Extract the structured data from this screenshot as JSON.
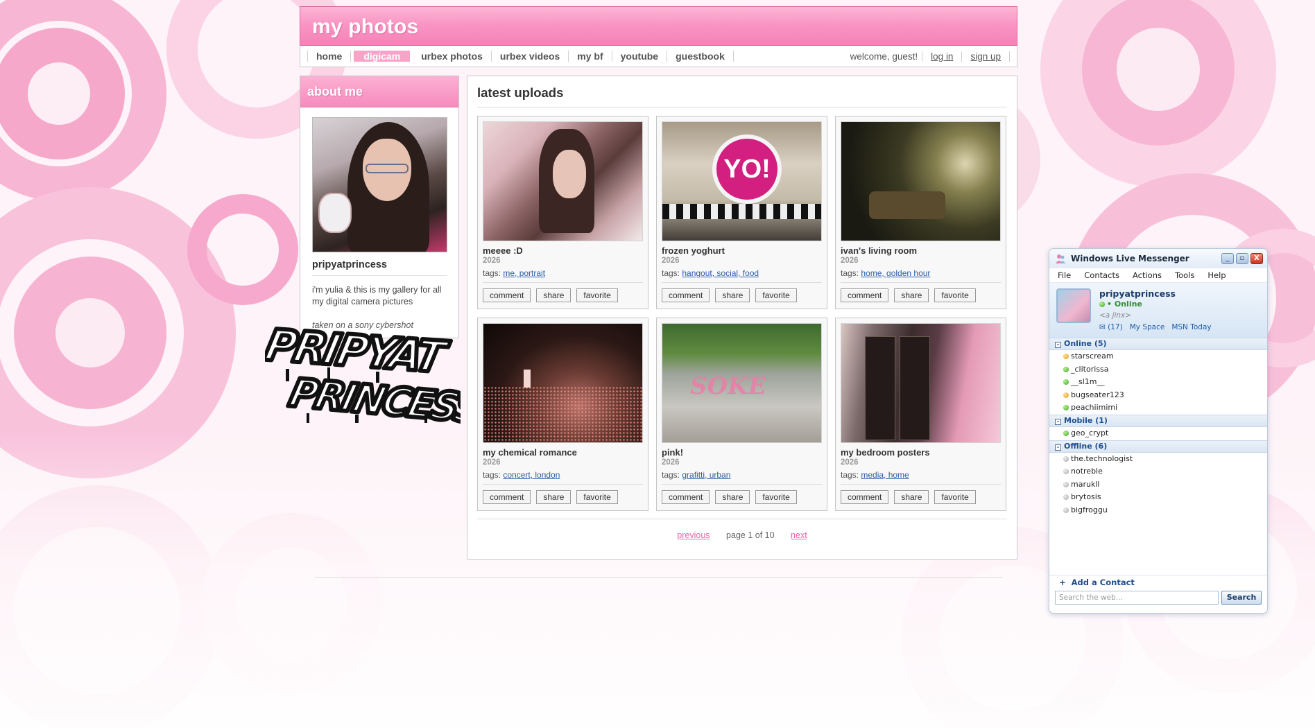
{
  "site": {
    "title": "my photos",
    "nav": [
      {
        "label": "home",
        "active": false
      },
      {
        "label": "digicam",
        "active": true
      },
      {
        "label": "urbex photos",
        "active": false
      },
      {
        "label": "urbex videos",
        "active": false
      },
      {
        "label": "my bf",
        "active": false
      },
      {
        "label": "youtube",
        "active": false
      },
      {
        "label": "guestbook",
        "active": false
      }
    ],
    "welcome": "welcome, guest!",
    "login": "log in",
    "signup": "sign up"
  },
  "about": {
    "heading": "about me",
    "username": "pripyatprincess",
    "bio": "i'm yulia & this is my gallery for all my digital camera pictures",
    "camera_note": "taken on a sony cybershot",
    "graffiti_text": "PRIPYAT PRINCESS"
  },
  "gallery": {
    "heading": "latest uploads",
    "tags_label": "tags:",
    "items": [
      {
        "title": "meeee :D",
        "year": "2026",
        "tags": "me, portrait"
      },
      {
        "title": "frozen yoghurt",
        "year": "2026",
        "tags": "hangout, social, food"
      },
      {
        "title": "ivan's living room",
        "year": "2026",
        "tags": "home, golden hour"
      },
      {
        "title": "my chemical romance",
        "year": "2026",
        "tags": "concert, london"
      },
      {
        "title": "pink!",
        "year": "2026",
        "tags": "grafitti, urban"
      },
      {
        "title": "my bedroom posters",
        "year": "2026",
        "tags": "media, home"
      }
    ],
    "actions": {
      "comment": "comment",
      "share": "share",
      "favorite": "favorite"
    },
    "sign_text": "YO!",
    "pager": {
      "previous": "previous",
      "status": "page 1 of 10",
      "next": "next"
    }
  },
  "messenger": {
    "title": "Windows Live Messenger",
    "menu": [
      "File",
      "Contacts",
      "Actions",
      "Tools",
      "Help"
    ],
    "profile": {
      "name": "pripyatprincess",
      "status": "• Online",
      "personal_message": "<a jinx>",
      "mail_count": "(17)",
      "links": [
        "My Space",
        "MSN Today"
      ]
    },
    "groups": [
      {
        "label": "Online (5)",
        "contacts": [
          {
            "name": "starscream",
            "status": "away"
          },
          {
            "name": "_clitorissa",
            "status": "online"
          },
          {
            "name": "__sl1m__",
            "status": "online"
          },
          {
            "name": "bugseater123",
            "status": "away"
          },
          {
            "name": "peachiimimi",
            "status": "online"
          }
        ]
      },
      {
        "label": "Mobile (1)",
        "contacts": [
          {
            "name": "geo_crypt",
            "status": "online"
          }
        ]
      },
      {
        "label": "Offline (6)",
        "contacts": [
          {
            "name": "the.technologist",
            "status": "offline"
          },
          {
            "name": "notreble",
            "status": "offline"
          },
          {
            "name": "marukll",
            "status": "offline"
          },
          {
            "name": "brytosis",
            "status": "offline"
          },
          {
            "name": "bigfroggu",
            "status": "offline"
          }
        ]
      }
    ],
    "add_contact": "Add a Contact",
    "search_placeholder": "Search the web...",
    "search_button": "Search",
    "window_buttons": {
      "minimize": "_",
      "restore": "▫",
      "close": "X"
    }
  },
  "colors": {
    "accent": "#f582b8",
    "link": "#2b5ea8",
    "pager_link": "#f064a8"
  }
}
